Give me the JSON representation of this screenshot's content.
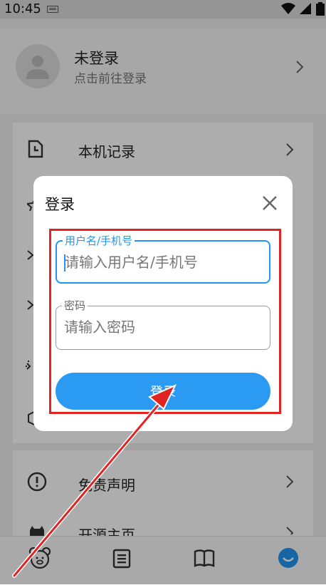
{
  "status_bar": {
    "time": "10:45",
    "icons": [
      "keyboard-icon",
      "wifi-icon",
      "signal-icon",
      "battery-icon"
    ]
  },
  "profile": {
    "name": "未登录",
    "subtitle": "点击前往登录"
  },
  "menu": {
    "items": [
      {
        "label": "本机记录",
        "icon": "history-icon"
      },
      {
        "label": "",
        "icon": "star-icon"
      },
      {
        "label": "",
        "icon": "download-icon"
      },
      {
        "label": "",
        "icon": "download-icon"
      },
      {
        "label": "",
        "icon": "settings-icon"
      },
      {
        "label": "",
        "icon": "box-icon"
      }
    ]
  },
  "bottom_menu": {
    "items": [
      {
        "label": "免责声明",
        "icon": "alert-icon"
      },
      {
        "label": "开源主页",
        "icon": "github-icon"
      }
    ]
  },
  "tabbar": {
    "tabs": [
      {
        "icon": "bear-icon"
      },
      {
        "icon": "list-icon"
      },
      {
        "icon": "book-icon"
      },
      {
        "icon": "profile-icon",
        "active": true
      }
    ]
  },
  "login_dialog": {
    "title": "登录",
    "username": {
      "label": "用户名/手机号",
      "placeholder": "请输入用户名/手机号",
      "value": ""
    },
    "password": {
      "label": "密码",
      "placeholder": "请输入密码",
      "value": ""
    },
    "submit_label": "登录"
  },
  "colors": {
    "accent": "#2196f3",
    "button": "#2b9af3",
    "annotation": "#e02424"
  }
}
